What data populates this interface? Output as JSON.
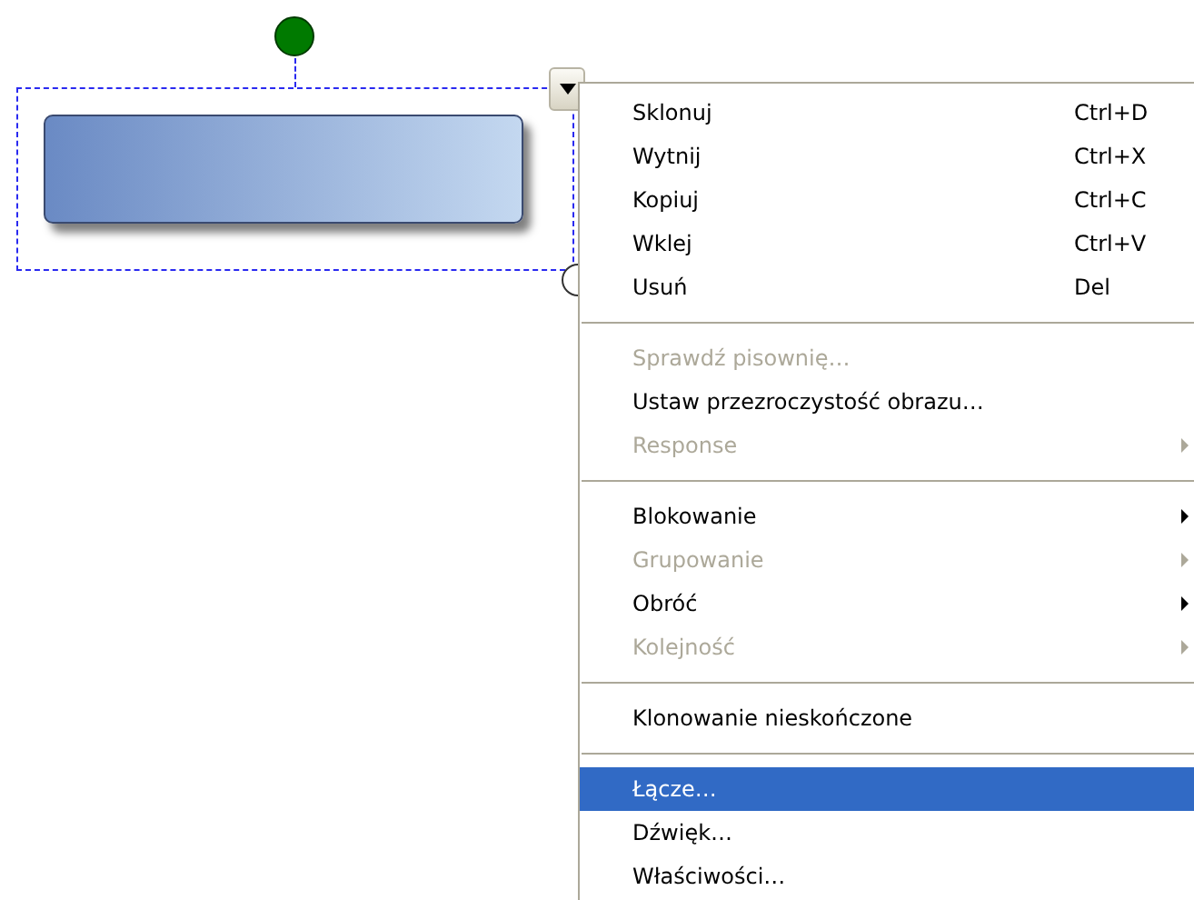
{
  "context_menu": {
    "items": [
      {
        "kind": "item",
        "label": "Sklonuj",
        "shortcut": "Ctrl+D",
        "disabled": false,
        "submenu": false,
        "selected": false
      },
      {
        "kind": "item",
        "label": "Wytnij",
        "shortcut": "Ctrl+X",
        "disabled": false,
        "submenu": false,
        "selected": false
      },
      {
        "kind": "item",
        "label": "Kopiuj",
        "shortcut": "Ctrl+C",
        "disabled": false,
        "submenu": false,
        "selected": false
      },
      {
        "kind": "item",
        "label": "Wklej",
        "shortcut": "Ctrl+V",
        "disabled": false,
        "submenu": false,
        "selected": false
      },
      {
        "kind": "item",
        "label": "Usuń",
        "shortcut": "Del",
        "disabled": false,
        "submenu": false,
        "selected": false
      },
      {
        "kind": "separator"
      },
      {
        "kind": "item",
        "label": "Sprawdź pisownię…",
        "disabled": true,
        "submenu": false,
        "selected": false
      },
      {
        "kind": "item",
        "label": "Ustaw przezroczystość obrazu…",
        "disabled": false,
        "submenu": false,
        "selected": false
      },
      {
        "kind": "item",
        "label": "Response",
        "disabled": true,
        "submenu": true,
        "selected": false
      },
      {
        "kind": "separator"
      },
      {
        "kind": "item",
        "label": "Blokowanie",
        "disabled": false,
        "submenu": true,
        "selected": false
      },
      {
        "kind": "item",
        "label": "Grupowanie",
        "disabled": true,
        "submenu": true,
        "selected": false
      },
      {
        "kind": "item",
        "label": "Obróć",
        "disabled": false,
        "submenu": true,
        "selected": false
      },
      {
        "kind": "item",
        "label": "Kolejność",
        "disabled": true,
        "submenu": true,
        "selected": false
      },
      {
        "kind": "separator"
      },
      {
        "kind": "item",
        "label": "Klonowanie nieskończone",
        "disabled": false,
        "submenu": false,
        "selected": false
      },
      {
        "kind": "separator"
      },
      {
        "kind": "item",
        "label": "Łącze…",
        "disabled": false,
        "submenu": false,
        "selected": true
      },
      {
        "kind": "item",
        "label": "Dźwięk…",
        "disabled": false,
        "submenu": false,
        "selected": false
      },
      {
        "kind": "item",
        "label": "Właściwości…",
        "disabled": false,
        "submenu": false,
        "selected": false
      }
    ]
  }
}
